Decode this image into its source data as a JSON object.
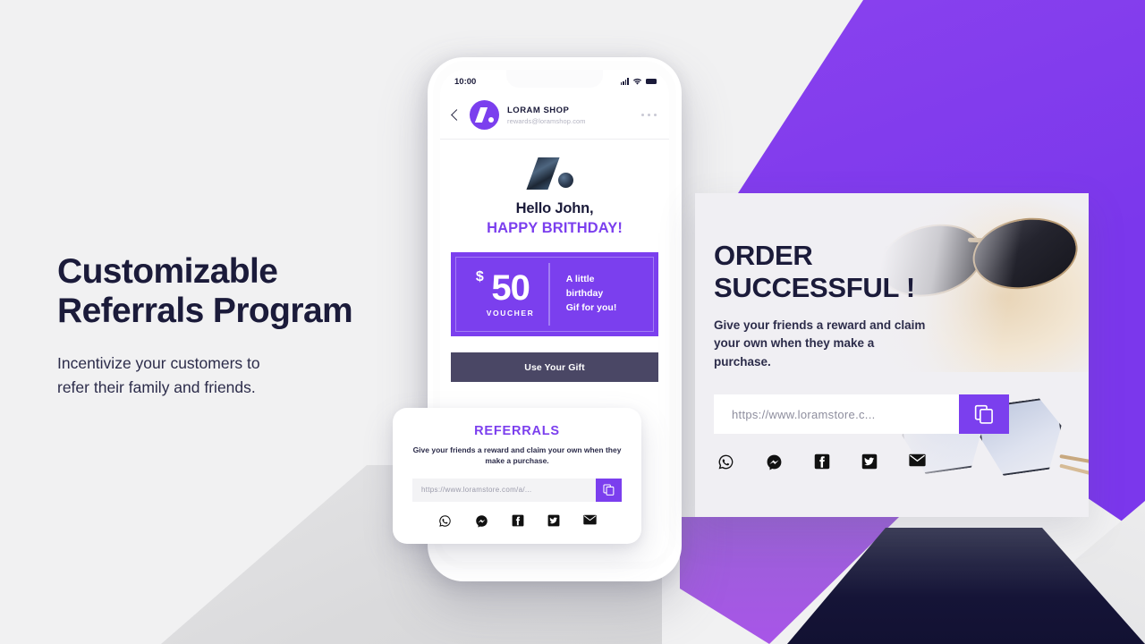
{
  "theme": {
    "purple": "#7b3fee",
    "navy": "#1b1b3a",
    "slate": "#4a4765",
    "page_bg": "#f1f1f2",
    "card_bg": "#f0eff3"
  },
  "headline": {
    "line1": "Customizable",
    "line2": "Referrals Program",
    "sub_line1": "Incentivize your customers to",
    "sub_line2": "refer their family and friends."
  },
  "phone": {
    "status": {
      "time": "10:00",
      "signal_icon": "signal-bars-icon",
      "wifi_icon": "wifi-icon",
      "battery_icon": "battery-icon"
    },
    "mail_header": {
      "back_icon": "back-chevron-icon",
      "avatar_icon": "loram-logo-icon",
      "sender": "LORAM SHOP",
      "email": "rewards@loramshop.com",
      "more_icon": "more-options-icon"
    },
    "body": {
      "brand_icon": "loram-brand-mark-icon",
      "greeting": "Hello John,",
      "occasion": "HAPPY BRITHDAY!"
    },
    "voucher": {
      "currency": "$",
      "amount": "50",
      "label": "VOUCHER",
      "message": "A little\nbirthday\nGif for you!"
    },
    "cta_label": "Use Your Gift"
  },
  "referrals_card": {
    "title": "REFERRALS",
    "description": "Give your friends a reward and claim your own when they make a purchase.",
    "url_value": "https://www.loramstore.com/a/...",
    "copy_icon": "copy-icon",
    "social": [
      {
        "name": "whatsapp-icon",
        "label": "WhatsApp"
      },
      {
        "name": "messenger-icon",
        "label": "Messenger"
      },
      {
        "name": "facebook-icon",
        "label": "Facebook"
      },
      {
        "name": "twitter-icon",
        "label": "Twitter"
      },
      {
        "name": "email-icon",
        "label": "Email"
      }
    ]
  },
  "order_card": {
    "title_line1": "ORDER",
    "title_line2": "SUCCESSFUL !",
    "description": "Give your friends a reward and claim your own when they make a purchase.",
    "url_value": "https://www.loramstore.c...",
    "copy_icon": "copy-icon",
    "social": [
      {
        "name": "whatsapp-icon",
        "label": "WhatsApp"
      },
      {
        "name": "messenger-icon",
        "label": "Messenger"
      },
      {
        "name": "facebook-icon",
        "label": "Facebook"
      },
      {
        "name": "twitter-icon",
        "label": "Twitter"
      },
      {
        "name": "email-icon",
        "label": "Email"
      }
    ],
    "photo_icon": "sunglasses-photo"
  }
}
